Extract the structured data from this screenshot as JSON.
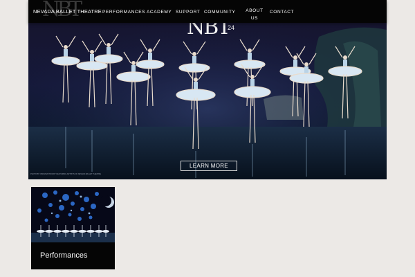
{
  "header": {
    "brand_mark": "NBT",
    "brand_name": "NEVADA BALLET THEATRE",
    "nav": [
      {
        "label": "PERFORMANCES"
      },
      {
        "label": "ACADEMY"
      },
      {
        "label": "SUPPORT"
      },
      {
        "label": "COMMUNITY"
      },
      {
        "label": "ABOUT US"
      },
      {
        "label": "CONTACT"
      }
    ]
  },
  "hero": {
    "logo": "NBT",
    "logo_season": "24",
    "cta_label": "LEARN MORE",
    "photo_credit": "PHOTO BY VIRGINIA TROUDT FEATURING ARTISTS OF NEVADA BALLET THEATRE"
  },
  "cards": [
    {
      "label": "Performances"
    }
  ],
  "colors": {
    "nav_bg": "#050505",
    "page_bg": "#ece9e6",
    "hero_bg": "#15193a",
    "tutu": "#cfe3f2"
  }
}
